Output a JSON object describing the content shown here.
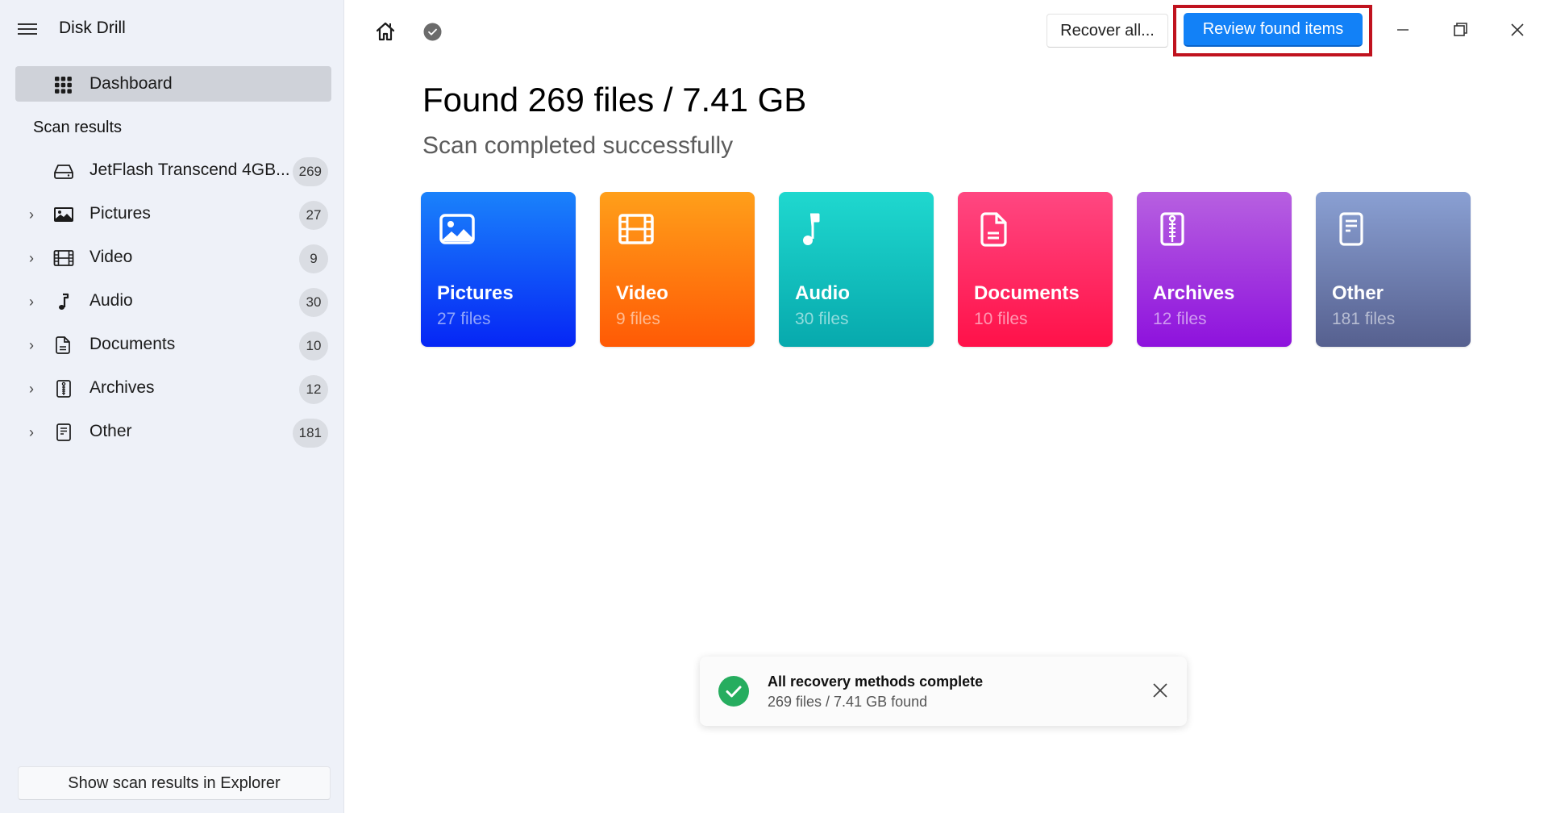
{
  "app": {
    "title": "Disk Drill"
  },
  "sidebar": {
    "dashboard_label": "Dashboard",
    "section_title": "Scan results",
    "device": {
      "label": "JetFlash Transcend 4GB...",
      "count": "269",
      "icon": "drive-icon"
    },
    "items": [
      {
        "label": "Pictures",
        "count": "27",
        "icon": "image-icon"
      },
      {
        "label": "Video",
        "count": "9",
        "icon": "film-icon"
      },
      {
        "label": "Audio",
        "count": "30",
        "icon": "music-note-icon"
      },
      {
        "label": "Documents",
        "count": "10",
        "icon": "document-icon"
      },
      {
        "label": "Archives",
        "count": "12",
        "icon": "archive-zip-icon"
      },
      {
        "label": "Other",
        "count": "181",
        "icon": "file-lines-icon"
      }
    ],
    "explorer_button": "Show scan results in Explorer"
  },
  "toolbar": {
    "recover_all": "Recover all...",
    "review_found": "Review found items"
  },
  "main": {
    "headline": "Found 269 files / 7.41 GB",
    "subline": "Scan completed successfully",
    "cards": [
      {
        "title": "Pictures",
        "count": "27 files",
        "icon": "image-icon",
        "color_top": "#1a82fb",
        "color_bottom": "#0626f5"
      },
      {
        "title": "Video",
        "count": "9 files",
        "icon": "film-icon",
        "color_top": "#ff9f1a",
        "color_bottom": "#ff5a05"
      },
      {
        "title": "Audio",
        "count": "30 files",
        "icon": "music-note-icon",
        "color_top": "#1fd8cf",
        "color_bottom": "#07a9ad"
      },
      {
        "title": "Documents",
        "count": "10 files",
        "icon": "document-icon",
        "color_top": "#ff4781",
        "color_bottom": "#ff1149"
      },
      {
        "title": "Archives",
        "count": "12 files",
        "icon": "archive-zip-icon",
        "color_top": "#b760e0",
        "color_bottom": "#8e12dd"
      },
      {
        "title": "Other",
        "count": "181 files",
        "icon": "file-lines-icon",
        "color_top": "#8aa0d3",
        "color_bottom": "#56608f"
      }
    ]
  },
  "toast": {
    "title": "All recovery methods complete",
    "subtitle": "269 files / 7.41 GB found",
    "status_color": "#26ad5f"
  },
  "colors": {
    "accent": "#1281f7",
    "highlight": "#c0121e"
  }
}
